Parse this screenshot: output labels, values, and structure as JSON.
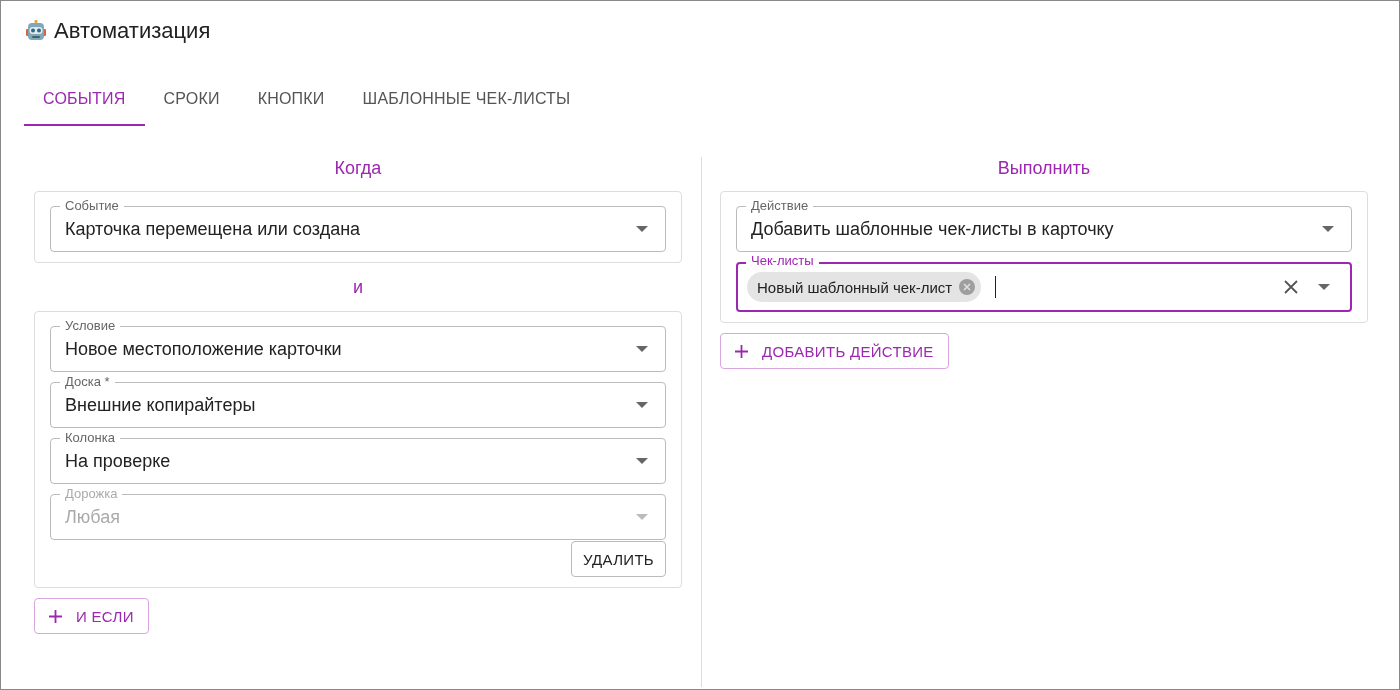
{
  "title": "Автоматизация",
  "tabs": [
    {
      "label": "СОБЫТИЯ",
      "selected": true
    },
    {
      "label": "СРОКИ",
      "selected": false
    },
    {
      "label": "КНОПКИ",
      "selected": false
    },
    {
      "label": "ШАБЛОННЫЕ ЧЕК-ЛИСТЫ",
      "selected": false
    }
  ],
  "when": {
    "heading": "Когда",
    "event": {
      "label": "Событие",
      "value": "Карточка перемещена или создана"
    }
  },
  "connector": "и",
  "conditions": {
    "fields": [
      {
        "label": "Условие",
        "value": "Новое местоположение карточки",
        "disabled": false
      },
      {
        "label": "Доска *",
        "value": "Внешние копирайтеры",
        "disabled": false
      },
      {
        "label": "Колонка",
        "value": "На проверке",
        "disabled": false
      },
      {
        "label": "Дорожка",
        "value": "Любая",
        "disabled": true
      }
    ],
    "delete_button": "УДАЛИТЬ"
  },
  "add_if_button": "И ЕСЛИ",
  "do": {
    "heading": "Выполнить",
    "action": {
      "label": "Действие",
      "value": "Добавить шаблонные чек-листы в карточку"
    },
    "checklists": {
      "label": "Чек-листы",
      "focused": true,
      "chips": [
        "Новый шаблонный чек-лист"
      ]
    }
  },
  "add_action_button": "ДОБАВИТЬ ДЕЙСТВИЕ"
}
